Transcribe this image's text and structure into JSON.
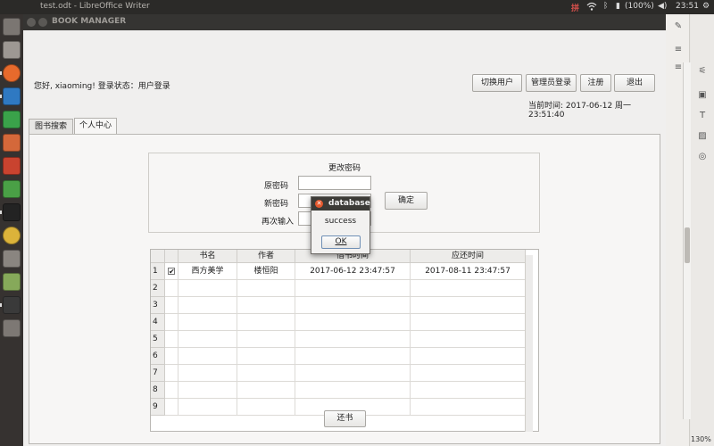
{
  "topbar": {
    "window_title": "test.odt - LibreOffice Writer",
    "battery": "(100%)",
    "clock": "23:51",
    "indicator_icons": [
      "input-method-icon",
      "wifi-icon",
      "bluetooth-icon",
      "battery-icon",
      "volume-icon",
      "settings-icon"
    ]
  },
  "launcher": {
    "apps": [
      "dash-icon",
      "files-icon",
      "firefox-icon",
      "writer-icon",
      "calc-icon",
      "impress-icon",
      "software-center-icon",
      "terminal-icon",
      "clion-icon",
      "chrome-icon",
      "settings-icon",
      "android-icon",
      "terminal-icon",
      "workspace-icon"
    ]
  },
  "app": {
    "title": "BOOK MANAGER",
    "greeting": "您好, xiaoming! 登录状态：用户登录",
    "buttons": {
      "switch_user": "切换用户",
      "admin_login": "管理员登录",
      "register": "注册",
      "logout": "退出"
    },
    "current_time": "当前时间: 2017-06-12 周一 23:51:40",
    "tabs": [
      "图书搜索",
      "个人中心"
    ],
    "active_tab": "个人中心",
    "change_password": {
      "title": "更改密码",
      "old_label": "原密码",
      "new_label": "新密码",
      "repeat_label": "再次输入",
      "old_value": "",
      "new_value": "",
      "repeat_value": "",
      "confirm": "确定"
    },
    "table": {
      "columns": [
        "",
        "书名",
        "作者",
        "借书时间",
        "应还时间"
      ],
      "rows": [
        {
          "num": "1",
          "checked": "✔",
          "title": "西方美学",
          "author": "楼恒阳",
          "borrow": "2017-06-12 23:47:57",
          "due": "2017-08-11 23:47:57"
        },
        {
          "num": "2",
          "checked": "",
          "title": "",
          "author": "",
          "borrow": "",
          "due": ""
        },
        {
          "num": "3",
          "checked": "",
          "title": "",
          "author": "",
          "borrow": "",
          "due": ""
        },
        {
          "num": "4",
          "checked": "",
          "title": "",
          "author": "",
          "borrow": "",
          "due": ""
        },
        {
          "num": "5",
          "checked": "",
          "title": "",
          "author": "",
          "borrow": "",
          "due": ""
        },
        {
          "num": "6",
          "checked": "",
          "title": "",
          "author": "",
          "borrow": "",
          "due": ""
        },
        {
          "num": "7",
          "checked": "",
          "title": "",
          "author": "",
          "borrow": "",
          "due": ""
        },
        {
          "num": "8",
          "checked": "",
          "title": "",
          "author": "",
          "borrow": "",
          "due": ""
        },
        {
          "num": "9",
          "checked": "",
          "title": "",
          "author": "",
          "borrow": "",
          "due": ""
        }
      ],
      "return_button": "还书"
    }
  },
  "dialog": {
    "title": "database",
    "message": "success",
    "ok": "OK"
  },
  "right_pane": {
    "zoom": "130%"
  },
  "colors": {
    "panel": "#2b2a28",
    "launcher": "#363230",
    "window_title": "#353432",
    "background": "#f0efee",
    "close_button": "#e5582d"
  }
}
